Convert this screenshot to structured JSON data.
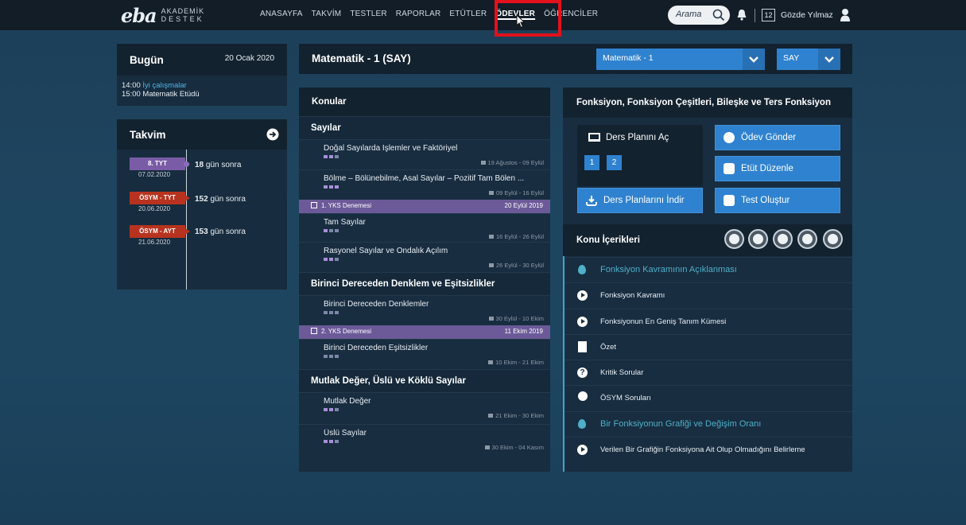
{
  "header": {
    "logo": "eba",
    "logo_sub1": "AKADEMİK",
    "logo_sub2": "DESTEK",
    "nav": [
      {
        "label": "ANASAYFA"
      },
      {
        "label": "TAKVİM"
      },
      {
        "label": "TESTLER"
      },
      {
        "label": "RAPORLAR"
      },
      {
        "label": "ETÜTLER"
      },
      {
        "label": "ÖDEVLER",
        "active": true
      },
      {
        "label": "ÖĞRENCİLER"
      }
    ],
    "search_placeholder": "Arama",
    "calendar_day": "12",
    "user_name": "Gözde Yılmaz",
    "highlight_color": "#e2111b"
  },
  "today": {
    "title": "Bugün",
    "date": "20 Ocak 2020",
    "events": [
      {
        "time": "14:00",
        "text": "İyi çalışmalar",
        "link": true
      },
      {
        "time": "15:00",
        "text": "Matematik Etüdü",
        "link": false
      }
    ]
  },
  "calendar": {
    "title": "Takvim",
    "exams": [
      {
        "tag": "8. TYT",
        "date": "07.02.2020",
        "days": "18",
        "suffix": "gün sonra",
        "color": "#7a5ca6"
      },
      {
        "tag": "ÖSYM - TYT",
        "date": "20.06.2020",
        "days": "152",
        "suffix": "gün sonra",
        "color": "#b8331f"
      },
      {
        "tag": "ÖSYM - AYT",
        "date": "21.06.2020",
        "days": "153",
        "suffix": "gün sonra",
        "color": "#b8331f"
      }
    ]
  },
  "main": {
    "title": "Matematik - 1 (SAY)",
    "course_select": "Matematik - 1",
    "track_select": "SAY"
  },
  "topics": {
    "title": "Konular",
    "sections": [
      {
        "name": "Sayılar",
        "items": [
          {
            "kind": "topic",
            "name": "Doğal Sayılarda İşlemler ve Faktöriyel",
            "dates": "19 Ağustos - 09 Eylül",
            "progress": 2
          },
          {
            "kind": "topic",
            "name": "Bölme – Bölünebilme, Asal Sayılar – Pozitif Tam Bölen ...",
            "dates": "09 Eylül - 16 Eylül",
            "progress": 3
          },
          {
            "kind": "exam",
            "name": "1. YKS Denemesi",
            "dates": "20 Eylül 2019"
          },
          {
            "kind": "topic",
            "name": "Tam Sayılar",
            "dates": "16 Eylül - 26 Eylül",
            "progress": 1
          },
          {
            "kind": "topic",
            "name": "Rasyonel Sayılar ve Ondalık Açılım",
            "dates": "26 Eylül - 30 Eylül",
            "progress": 2
          }
        ]
      },
      {
        "name": "Birinci Dereceden Denklem ve Eşitsizlikler",
        "items": [
          {
            "kind": "topic",
            "name": "Birinci Dereceden Denklemler",
            "dates": "30 Eylül - 10 Ekim",
            "progress": 0
          },
          {
            "kind": "exam",
            "name": "2. YKS Denemesi",
            "dates": "11 Ekim 2019"
          },
          {
            "kind": "topic",
            "name": "Birinci Dereceden Eşitsizlikler",
            "dates": "10 Ekim - 21 Ekim",
            "progress": 0
          }
        ]
      },
      {
        "name": "Mutlak Değer, Üslü ve Köklü Sayılar",
        "items": [
          {
            "kind": "topic",
            "name": "Mutlak Değer",
            "dates": "21 Ekim - 30 Ekim",
            "progress": 2
          },
          {
            "kind": "topic",
            "name": "Üslü Sayılar",
            "dates": "30 Ekim - 04 Kasım",
            "progress": 2
          }
        ]
      }
    ]
  },
  "detail": {
    "title": "Fonksiyon, Fonksiyon Çeşitleri, Bileşke ve Ters Fonksiyon",
    "lesson_plan_label": "Ders Planını Aç",
    "plan_pages": [
      "1",
      "2"
    ],
    "download_label": "Ders Planlarını İndir",
    "assign_label": "Ödev Gönder",
    "study_label": "Etüt Düzenle",
    "test_label": "Test Oluştur",
    "content_title": "Konu İçerikleri",
    "content_icons": [
      "play-icon",
      "question-icon",
      "medal-icon",
      "document-icon",
      "grid-icon"
    ],
    "contents": [
      {
        "type": "heading",
        "label": "Fonksiyon Kavramının Açıklanması"
      },
      {
        "type": "video",
        "label": "Fonksiyon Kavramı"
      },
      {
        "type": "video",
        "label": "Fonksiyonun En Geniş Tanım Kümesi"
      },
      {
        "type": "document",
        "label": "Özet"
      },
      {
        "type": "question",
        "label": "Kritik Sorular"
      },
      {
        "type": "medal",
        "label": "ÖSYM Soruları"
      },
      {
        "type": "heading",
        "label": "Bir Fonksiyonun Grafiği ve Değişim Oranı"
      },
      {
        "type": "video",
        "label": "Verilen Bir Grafiğin Fonksiyona Ait Olup Olmadığını Belirleme"
      }
    ]
  }
}
